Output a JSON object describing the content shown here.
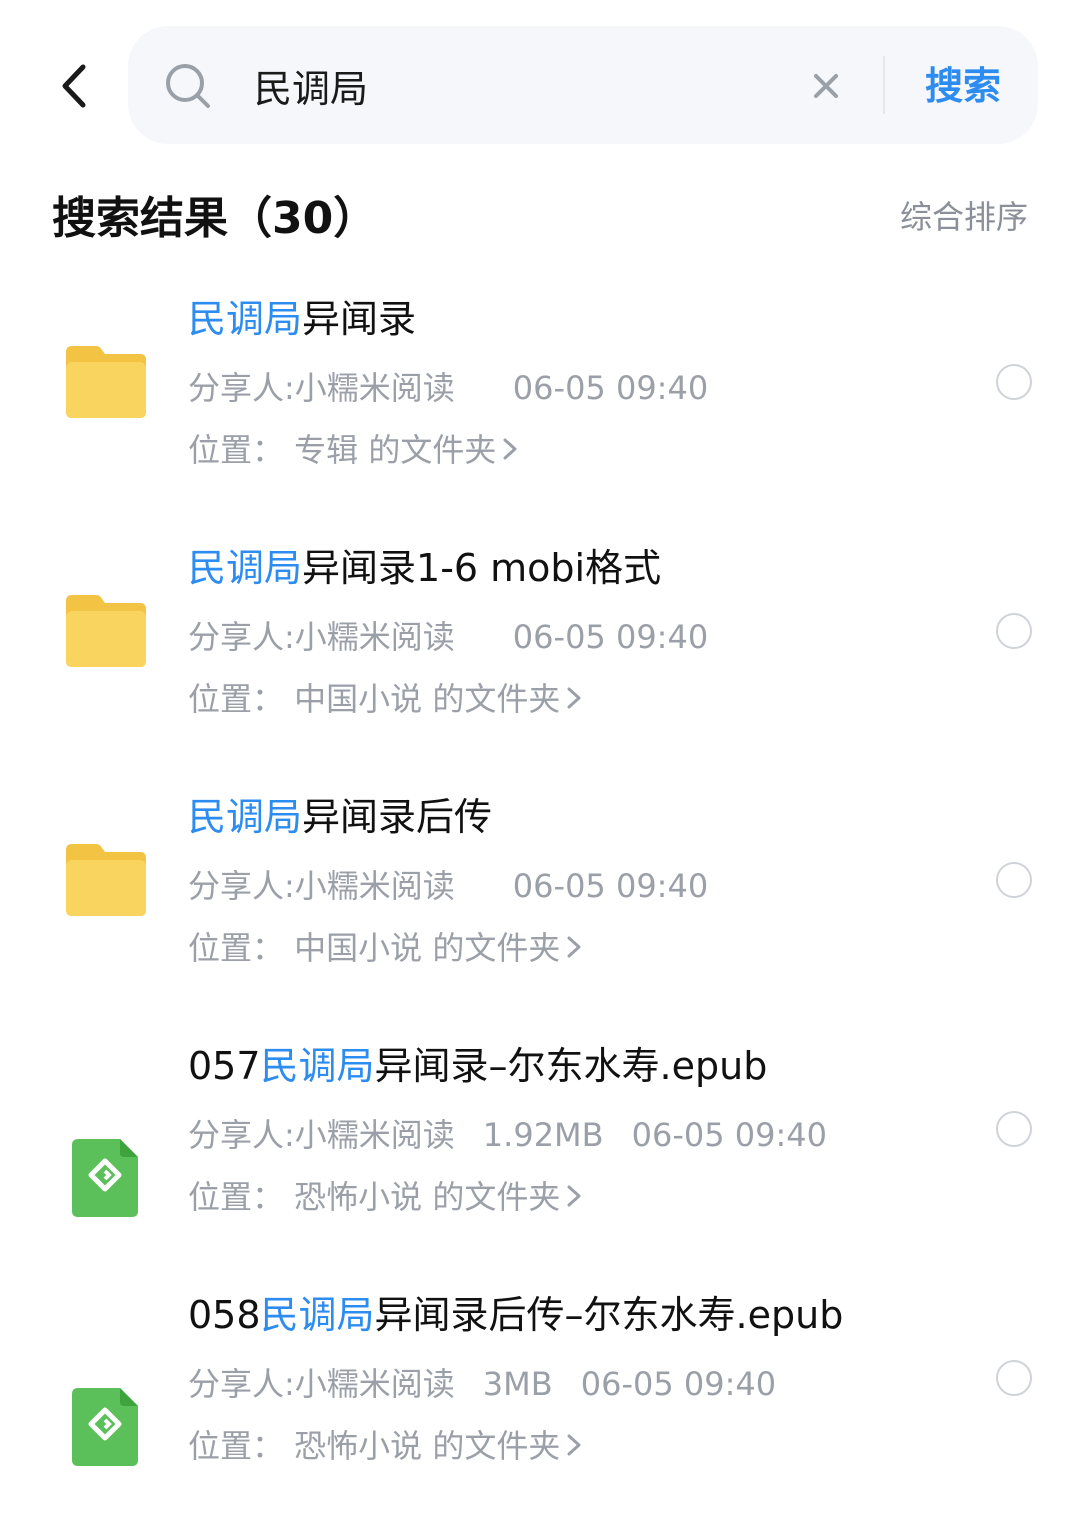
{
  "search": {
    "query": "民调局",
    "search_label": "搜索"
  },
  "results": {
    "title": "搜索结果（30）",
    "sort_label": "综合排序"
  },
  "colors": {
    "accent": "#2d8cf0",
    "folder": "#f7cf55",
    "epub": "#5cc05a",
    "muted": "#9ba0a8"
  },
  "items": [
    {
      "type": "folder",
      "icon": "folder-icon",
      "name_prefix": "",
      "name_highlight": "民调局",
      "name_suffix": "异闻录",
      "sharer": "分享人:小糯米阅读",
      "size": "",
      "time": "06-05 09:40",
      "location": "位置：  专辑 的文件夹"
    },
    {
      "type": "folder",
      "icon": "folder-icon",
      "name_prefix": "",
      "name_highlight": "民调局",
      "name_suffix": "异闻录1-6 mobi格式",
      "sharer": "分享人:小糯米阅读",
      "size": "",
      "time": "06-05 09:40",
      "location": "位置：  中国小说 的文件夹"
    },
    {
      "type": "folder",
      "icon": "folder-icon",
      "name_prefix": "",
      "name_highlight": "民调局",
      "name_suffix": "异闻录后传",
      "sharer": "分享人:小糯米阅读",
      "size": "",
      "time": "06-05 09:40",
      "location": "位置：  中国小说 的文件夹"
    },
    {
      "type": "epub",
      "icon": "epub-file-icon",
      "name_prefix": "057",
      "name_highlight": "民调局",
      "name_suffix": "异闻录–尔东水寿.epub",
      "sharer": "分享人:小糯米阅读",
      "size": "1.92MB",
      "time": "06-05 09:40",
      "location": "位置：  恐怖小说 的文件夹"
    },
    {
      "type": "epub",
      "icon": "epub-file-icon",
      "name_prefix": "058",
      "name_highlight": "民调局",
      "name_suffix": "异闻录后传–尔东水寿.epub",
      "sharer": "分享人:小糯米阅读",
      "size": "3MB",
      "time": "06-05 09:40",
      "location": "位置：  恐怖小说 的文件夹"
    }
  ]
}
